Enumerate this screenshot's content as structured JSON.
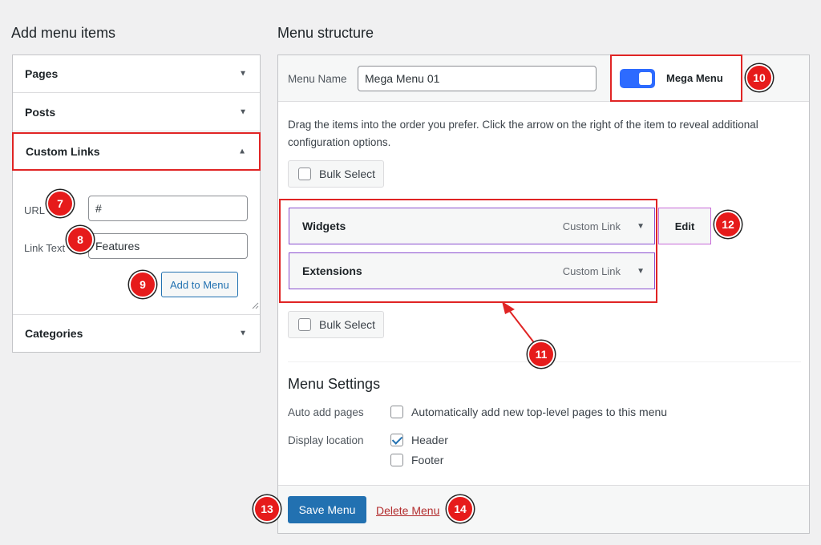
{
  "left": {
    "heading": "Add menu items",
    "accordion": [
      {
        "label": "Pages"
      },
      {
        "label": "Posts"
      },
      {
        "label": "Custom Links"
      },
      {
        "label": "Categories"
      }
    ],
    "custom_links": {
      "url_label": "URL",
      "url_value": "#",
      "link_text_label": "Link Text",
      "link_text_value": "Features",
      "add_button": "Add to Menu"
    }
  },
  "right": {
    "heading": "Menu structure",
    "menu_name_label": "Menu Name",
    "menu_name_value": "Mega Menu 01",
    "mega_menu_label": "Mega Menu",
    "mega_menu_enabled": true,
    "instructions": "Drag the items into the order you prefer. Click the arrow on the right of the item to reveal additional configuration options.",
    "bulk_select": "Bulk Select",
    "items": [
      {
        "title": "Widgets",
        "type": "Custom Link"
      },
      {
        "title": "Extensions",
        "type": "Custom Link"
      }
    ],
    "edit_button": "Edit",
    "settings": {
      "title": "Menu Settings",
      "auto_add_label": "Auto add pages",
      "auto_add_option": "Automatically add new top-level pages to this menu",
      "display_location_label": "Display location",
      "locations": [
        {
          "label": "Header",
          "checked": true
        },
        {
          "label": "Footer",
          "checked": false
        }
      ]
    },
    "save_button": "Save Menu",
    "delete_link": "Delete Menu"
  },
  "annotations": [
    "7",
    "8",
    "9",
    "10",
    "11",
    "12",
    "13",
    "14"
  ],
  "colors": {
    "primary": "#2271b1",
    "toggle": "#2d6bff",
    "highlight": "#e02424",
    "badge": "#e61b1b",
    "delete": "#b32d2e",
    "item_border": "#8a4fcf"
  }
}
